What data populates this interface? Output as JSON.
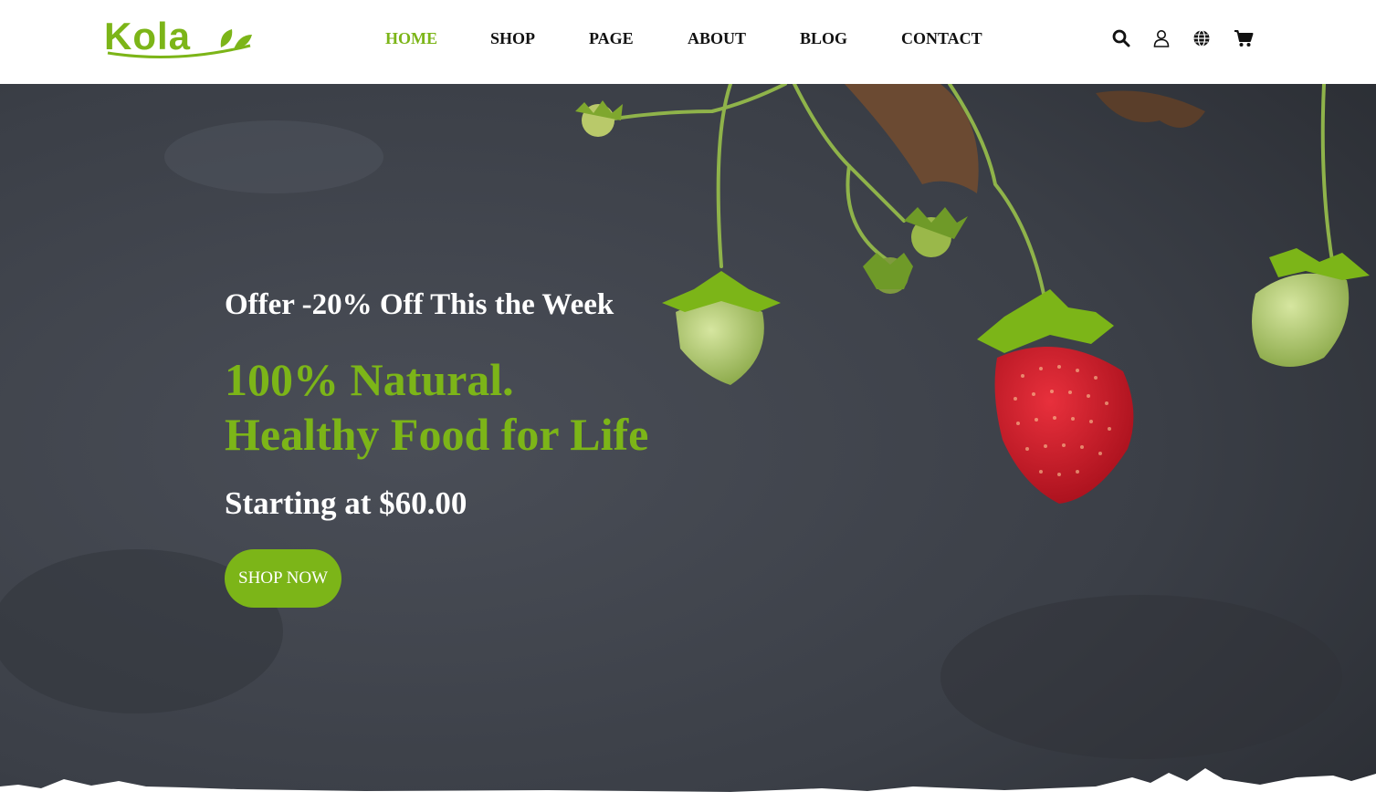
{
  "brand": {
    "name": "Kola",
    "color": "#7cb518",
    "leaf_icon": "leaf-icon"
  },
  "nav": {
    "items": [
      {
        "label": "HOME",
        "active": true
      },
      {
        "label": "SHOP",
        "active": false
      },
      {
        "label": "PAGE",
        "active": false
      },
      {
        "label": "ABOUT",
        "active": false
      },
      {
        "label": "BLOG",
        "active": false
      },
      {
        "label": "CONTACT",
        "active": false
      }
    ]
  },
  "header_icons": [
    "search-icon",
    "user-icon",
    "globe-icon",
    "cart-icon"
  ],
  "hero": {
    "offer": "Offer -20% Off This the Week",
    "headline_line1": "100% Natural.",
    "headline_line2": "Healthy Food for Life",
    "price": "Starting at $60.00",
    "cta_label": "SHOP NOW",
    "accent_color": "#7cb518",
    "background_color": "#3a3d44"
  }
}
